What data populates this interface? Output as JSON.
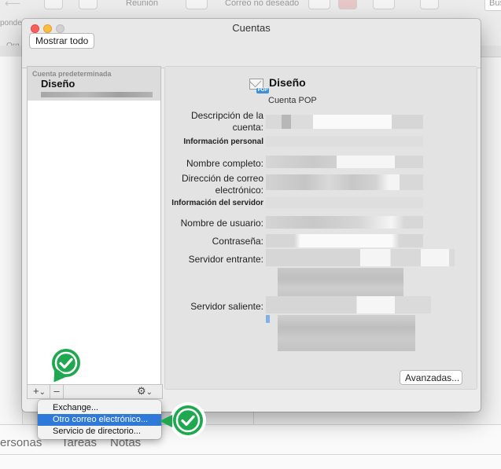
{
  "background": {
    "toolbar_reunion": "Reunión",
    "toolbar_junk": "Correo no deseado",
    "toolbar_search": "Bus",
    "left_respond": "ponde",
    "left_org": "Org",
    "nav": [
      "ersonas",
      "Tareas",
      "Notas"
    ]
  },
  "window": {
    "title": "Cuentas",
    "show_all": "Mostrar todo"
  },
  "account_list": {
    "section_label": "Cuenta predeterminada",
    "accounts": [
      {
        "name": "Diseño"
      }
    ],
    "add_label": "+",
    "add_chevron": "⌄",
    "remove_label": "–",
    "gear_label": "⚙",
    "gear_chevron": "⌄"
  },
  "account_detail": {
    "name": "Diseño",
    "type": "Cuenta POP",
    "icon_badge": "POP",
    "fields": {
      "description_label": "Descripción de la cuenta:",
      "personal_section": "Información personal",
      "fullname_label": "Nombre completo:",
      "email_label": "Dirección de correo electrónico:",
      "server_section": "Información del servidor",
      "username_label": "Nombre de usuario:",
      "password_label": "Contraseña:",
      "incoming_label": "Servidor entrante:",
      "outgoing_label": "Servidor saliente:"
    },
    "advanced_button": "Avanzadas..."
  },
  "add_menu": {
    "items": [
      {
        "label": "Exchange..."
      },
      {
        "label": "Otro correo electrónico...",
        "selected": true
      },
      {
        "label": "Servicio de directorio..."
      }
    ]
  },
  "colors": {
    "checkmark_green": "#1fa84f",
    "menu_highlight": "#2f7ad8"
  }
}
